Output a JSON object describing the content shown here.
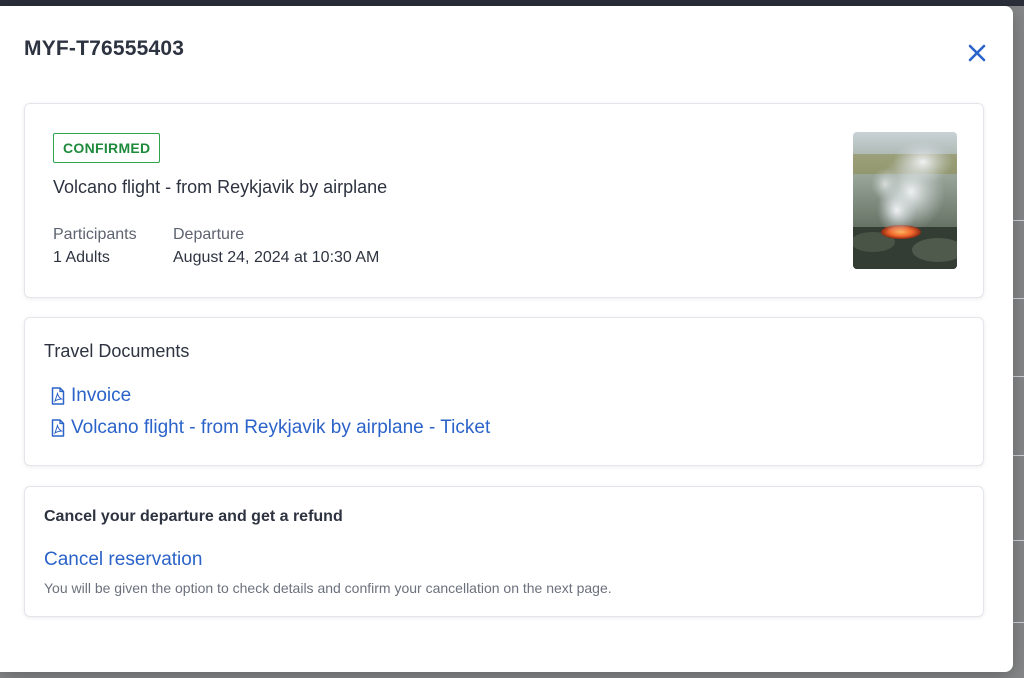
{
  "modal": {
    "title": "MYF-T76555403"
  },
  "booking": {
    "status": "CONFIRMED",
    "tour_title": "Volcano flight - from Reykjavik by airplane",
    "participants_label": "Participants",
    "participants_value": "1 Adults",
    "departure_label": "Departure",
    "departure_value": "August 24, 2024 at 10:30 AM"
  },
  "documents": {
    "title": "Travel Documents",
    "items": [
      {
        "label": "Invoice",
        "icon": "pdf-file-icon"
      },
      {
        "label": "Volcano flight - from Reykjavik by airplane - Ticket",
        "icon": "pdf-file-icon"
      }
    ]
  },
  "cancellation": {
    "title": "Cancel your departure and get a refund",
    "link_label": "Cancel reservation",
    "note": "You will be given the option to check details and confirm your cancellation on the next page."
  },
  "colors": {
    "link": "#2b63c9",
    "confirmed": "#1e8a3c",
    "text": "#2d3340"
  }
}
